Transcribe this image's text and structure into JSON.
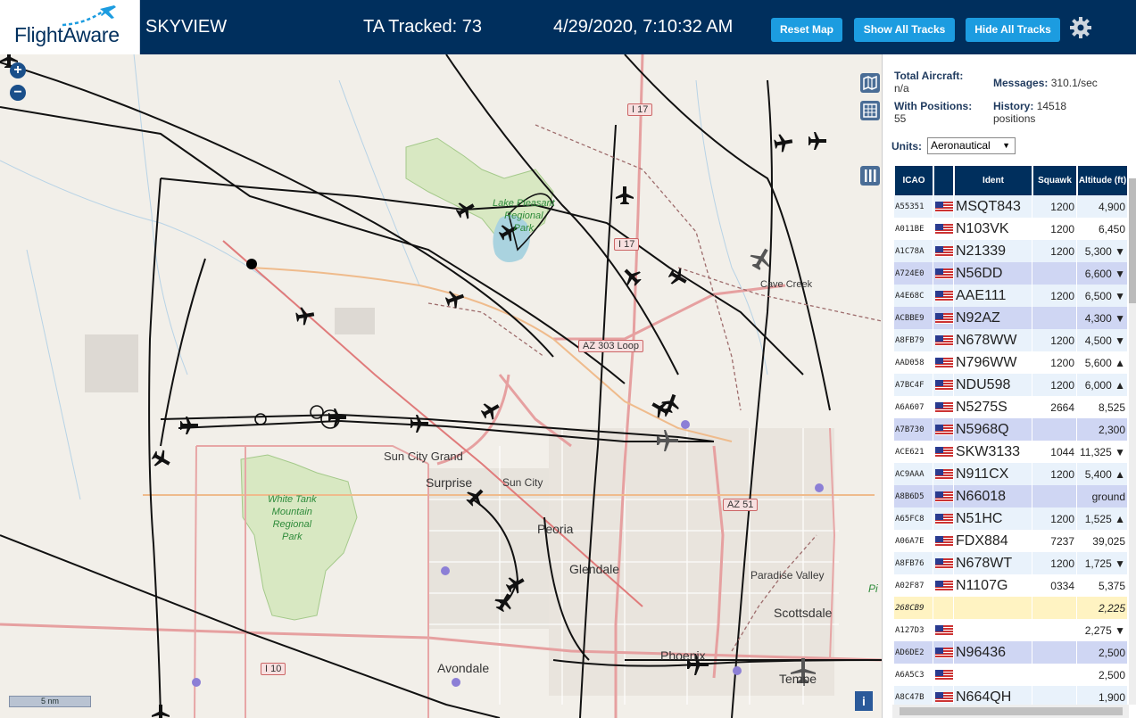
{
  "header": {
    "logo_text": "FlightAware",
    "app_title": "SKYVIEW",
    "tracked": "TA Tracked: 73",
    "datetime": "4/29/2020, 7:10:32 AM",
    "reset_label": "Reset Map",
    "show_label": "Show All Tracks",
    "hide_label": "Hide All Tracks",
    "settings_icon": "gear-icon"
  },
  "map": {
    "zoom_in": "+",
    "zoom_out": "−",
    "scale_label": "5 nm",
    "info_label": "i",
    "places": {
      "lake": "Lake Pleasant",
      "lake2": "Regional",
      "lake3": "Park",
      "cave_creek": "Cave Creek",
      "sun_city_grand": "Sun City Grand",
      "surprise": "Surprise",
      "sun_city": "Sun City",
      "peoria": "Peoria",
      "glendale": "Glendale",
      "paradise_valley": "Paradise Valley",
      "scottsdale": "Scottsdale",
      "phoenix": "Phoenix",
      "avondale": "Avondale",
      "tempe": "Tempe",
      "white_tank_1": "White Tank",
      "white_tank_2": "Mountain",
      "white_tank_3": "Regional",
      "white_tank_4": "Park",
      "pi": "Pi"
    },
    "shields": {
      "i17a": "I 17",
      "i17b": "I 17",
      "az303": "AZ 303 Loop",
      "az51": "AZ 51",
      "i10": "I 10"
    }
  },
  "panel": {
    "total_label": "Total Aircraft:",
    "total_value": "n/a",
    "positions_label": "With Positions:",
    "positions_value": "55",
    "messages_label": "Messages:",
    "messages_value": "310.1/sec",
    "history_label": "History:",
    "history_value": "14518",
    "history_unit": "positions",
    "units_label": "Units:",
    "units_value": "Aeronautical",
    "columns": [
      "ICAO",
      "",
      "Ident",
      "Squawk",
      "Altitude (ft)"
    ],
    "rows": [
      {
        "icao": "A55351",
        "ident": "MSQT843",
        "squawk": "1200",
        "alt": "4,900",
        "style": "odd"
      },
      {
        "icao": "A011BE",
        "ident": "N103VK",
        "squawk": "1200",
        "alt": "6,450",
        "style": "even"
      },
      {
        "icao": "A1C78A",
        "ident": "N21339",
        "squawk": "1200",
        "alt": "5,300 ▼",
        "style": "odd"
      },
      {
        "icao": "A724E0",
        "ident": "N56DD",
        "squawk": "",
        "alt": "6,600 ▼",
        "style": "sel"
      },
      {
        "icao": "A4E68C",
        "ident": "AAE111",
        "squawk": "1200",
        "alt": "6,500 ▼",
        "style": "odd"
      },
      {
        "icao": "ACBBE9",
        "ident": "N92AZ",
        "squawk": "",
        "alt": "4,300 ▼",
        "style": "sel"
      },
      {
        "icao": "A8FB79",
        "ident": "N678WW",
        "squawk": "1200",
        "alt": "4,500 ▼",
        "style": "odd"
      },
      {
        "icao": "AAD058",
        "ident": "N796WW",
        "squawk": "1200",
        "alt": "5,600 ▲",
        "style": "even"
      },
      {
        "icao": "A7BC4F",
        "ident": "NDU598",
        "squawk": "1200",
        "alt": "6,000 ▲",
        "style": "odd"
      },
      {
        "icao": "A6A607",
        "ident": "N5275S",
        "squawk": "2664",
        "alt": "8,525",
        "style": "even"
      },
      {
        "icao": "A7B730",
        "ident": "N5968Q",
        "squawk": "",
        "alt": "2,300",
        "style": "sel"
      },
      {
        "icao": "ACE621",
        "ident": "SKW3133",
        "squawk": "1044",
        "alt": "11,325 ▼",
        "style": "even"
      },
      {
        "icao": "AC9AAA",
        "ident": "N911CX",
        "squawk": "1200",
        "alt": "5,400 ▲",
        "style": "odd"
      },
      {
        "icao": "A8B6D5",
        "ident": "N66018",
        "squawk": "",
        "alt": "ground",
        "style": "sel"
      },
      {
        "icao": "A65FC8",
        "ident": "N51HC",
        "squawk": "1200",
        "alt": "1,525 ▲",
        "style": "odd"
      },
      {
        "icao": "A06A7E",
        "ident": "FDX884",
        "squawk": "7237",
        "alt": "39,025",
        "style": "even"
      },
      {
        "icao": "A8FB76",
        "ident": "N678WT",
        "squawk": "1200",
        "alt": "1,725 ▼",
        "style": "odd"
      },
      {
        "icao": "A02F87",
        "ident": "N1107G",
        "squawk": "0334",
        "alt": "5,375",
        "style": "even"
      },
      {
        "icao": "268CB9",
        "ident": "",
        "squawk": "",
        "alt": "2,225",
        "style": "yel",
        "noflag": true
      },
      {
        "icao": "A127D3",
        "ident": "",
        "squawk": "",
        "alt": "2,275 ▼",
        "style": "even"
      },
      {
        "icao": "AD6DE2",
        "ident": "N96436",
        "squawk": "",
        "alt": "2,500",
        "style": "sel"
      },
      {
        "icao": "A6A5C3",
        "ident": "",
        "squawk": "",
        "alt": "2,500",
        "style": "even"
      },
      {
        "icao": "A8C47B",
        "ident": "N664QH",
        "squawk": "",
        "alt": "1,900",
        "style": "odd"
      }
    ]
  }
}
